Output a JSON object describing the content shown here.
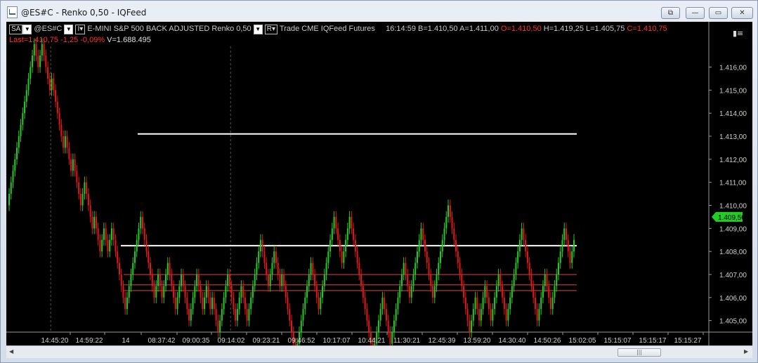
{
  "window": {
    "title": "@ES#C - Renko 0,50 - IQFeed",
    "buttons": [
      "⧉",
      "—",
      "▭",
      "✕"
    ]
  },
  "toolbar": {
    "sa_label": "SA",
    "symbol": "@ES#C",
    "instrument": "E-MINI S&P 500 BACK ADJUSTED",
    "bar_type": "Renko 0,50",
    "r_label": "R",
    "source": "Trade  CME  IQFeed  Futures",
    "time": "16:14:59",
    "bid": "B=1.410,50",
    "ask": "A=1.411,00",
    "open": "O=1.410,50",
    "high": "H=1.419,25",
    "low": "L=1.405,75",
    "close": "C=1.410,75",
    "last": "Last=1.410,75",
    "change": "-1,25",
    "change_pct": "-0,09%",
    "volume": "V=1.688.495",
    "panel_icon": "bars-menu-icon"
  },
  "chart_data": {
    "type": "candlestick",
    "chart_kind": "renko",
    "brick_size": 0.5,
    "y_range": [
      1404.5,
      1416.9
    ],
    "y_ticks": [
      "1.416,00",
      "1.415,00",
      "1.414,00",
      "1.413,00",
      "1.412,00",
      "1.411,00",
      "1.410,00",
      "1.409,00",
      "1.408,00",
      "1.407,00",
      "1.406,00",
      "1.405,00"
    ],
    "y_tick_values": [
      1416,
      1415,
      1414,
      1413,
      1412,
      1411,
      1410,
      1409,
      1408,
      1407,
      1406,
      1405
    ],
    "x_tick_labels": [
      "14:45:20",
      "14:59:22",
      "14",
      "08:37:42",
      "09:00:35",
      "09:14:02",
      "09:23:21",
      "09:46:52",
      "10:17:07",
      "10:44:21",
      "11:30:21",
      "12:45:39",
      "13:59:20",
      "14:30:40",
      "14:50:26",
      "15:02:05",
      "15:15:07",
      "15:15:17",
      "15:15:27"
    ],
    "last_price_label": "1.409,50",
    "last_price": 1409.5,
    "session_break_bars": [
      21,
      114
    ],
    "start_price": 1410.0,
    "moves": [
      1,
      1,
      1,
      1,
      1,
      1,
      1,
      1,
      1,
      1,
      1,
      1,
      1,
      1,
      -1,
      -1,
      1,
      1,
      -1,
      -1,
      -1,
      -1,
      1,
      -1,
      -1,
      -1,
      -1,
      -1,
      -1,
      1,
      -1,
      -1,
      -1,
      1,
      -1,
      -1,
      -1,
      -1,
      1,
      1,
      -1,
      -1,
      -1,
      -1,
      1,
      -1,
      -1,
      -1,
      1,
      1,
      -1,
      -1,
      1,
      1,
      -1,
      -1,
      -1,
      -1,
      -1,
      -1,
      -1,
      1,
      1,
      1,
      1,
      1,
      1,
      1,
      1,
      -1,
      -1,
      -1,
      -1,
      -1,
      -1,
      -1,
      1,
      1,
      -1,
      -1,
      1,
      1,
      1,
      -1,
      -1,
      -1,
      -1,
      1,
      1,
      1,
      -1,
      -1,
      -1,
      -1,
      1,
      1,
      1,
      1,
      -1,
      -1,
      -1,
      1,
      1,
      -1,
      -1,
      1,
      -1,
      -1,
      -1,
      1,
      1,
      1,
      1,
      1,
      -1,
      -1,
      -1,
      -1,
      1,
      1,
      1,
      -1,
      -1,
      -1,
      1,
      1,
      1,
      1,
      1,
      1,
      1,
      -1,
      -1,
      -1,
      -1,
      1,
      1,
      1,
      -1,
      -1,
      -1,
      1,
      -1,
      -1,
      -1,
      -1,
      -1,
      -1,
      -1,
      1,
      1,
      1,
      1,
      1,
      1,
      1,
      1,
      -1,
      -1,
      -1,
      -1,
      1,
      1,
      1,
      1,
      1,
      1,
      1,
      1,
      -1,
      -1,
      -1,
      -1,
      1,
      1,
      1,
      1,
      -1,
      -1,
      -1,
      -1,
      -1,
      -1,
      -1,
      -1,
      -1,
      -1,
      -1,
      -1,
      1,
      1,
      1,
      1,
      1,
      -1,
      -1,
      -1,
      -1,
      1,
      1,
      1,
      1,
      1,
      1,
      1,
      -1,
      -1,
      -1,
      1,
      1,
      1,
      1,
      1,
      1,
      -1,
      -1,
      -1,
      -1,
      -1,
      -1,
      1,
      1,
      1,
      1,
      1,
      1,
      1,
      1,
      -1,
      -1,
      -1,
      -1,
      -1,
      -1,
      -1,
      -1,
      -1,
      -1,
      -1,
      1,
      1,
      1,
      -1,
      -1,
      1,
      1,
      1,
      -1,
      -1,
      -1,
      1,
      1,
      1,
      1,
      -1,
      -1,
      -1,
      -1,
      1,
      1,
      1,
      1,
      1,
      1,
      1,
      1,
      -1,
      -1,
      -1,
      -1,
      -1,
      -1,
      -1,
      -1,
      1,
      1,
      1,
      1,
      -1,
      -1,
      -1,
      1,
      1,
      1,
      1,
      1,
      1,
      1,
      -1,
      -1,
      -1,
      1,
      1
    ],
    "horizontal_lines": [
      {
        "price": 1413.1,
        "color": "#ffffff"
      },
      {
        "price": 1408.25,
        "color": "#ffffff"
      },
      {
        "price": 1407.0,
        "color": "#e04040"
      },
      {
        "price": 1406.55,
        "color": "#e04040"
      },
      {
        "price": 1406.3,
        "color": "#e04040"
      }
    ],
    "colors": {
      "up": "#22cc22",
      "down": "#e01818",
      "background": "#000000",
      "price_tag": "#22cc22"
    }
  }
}
